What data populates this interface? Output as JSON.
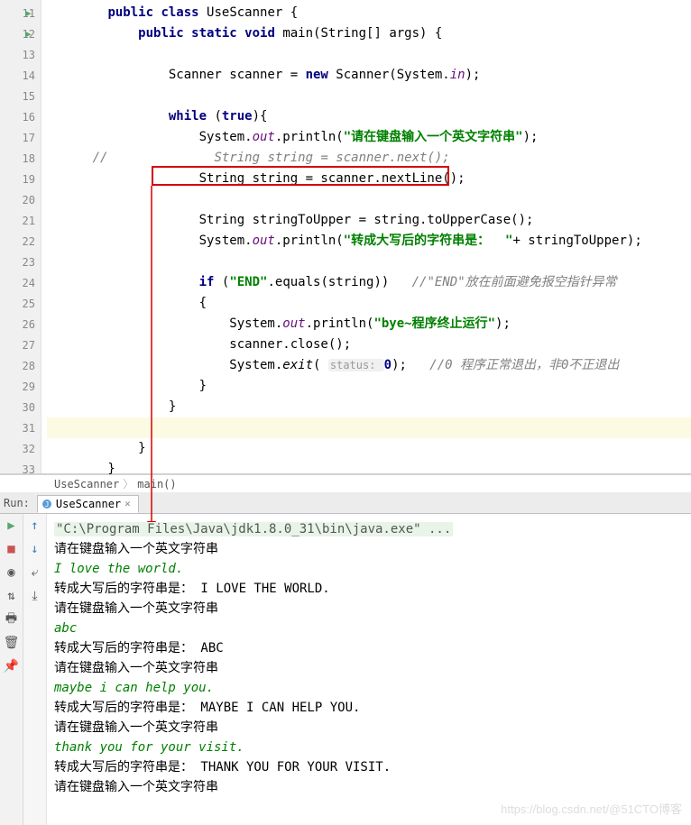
{
  "gutter": {
    "lines": [
      "11",
      "12",
      "13",
      "14",
      "15",
      "16",
      "17",
      "18",
      "19",
      "20",
      "21",
      "22",
      "23",
      "24",
      "25",
      "26",
      "27",
      "28",
      "29",
      "30",
      "31",
      "32",
      "33"
    ],
    "runMarkers": [
      11,
      12
    ]
  },
  "code": {
    "l11": {
      "indent": "        ",
      "tokens": [
        {
          "t": "public ",
          "c": "kw"
        },
        {
          "t": "class ",
          "c": "kw"
        },
        {
          "t": "UseScanner {",
          "c": ""
        }
      ]
    },
    "l12": {
      "indent": "            ",
      "tokens": [
        {
          "t": "public static void ",
          "c": "kw"
        },
        {
          "t": "main(String[] args) {",
          "c": ""
        }
      ]
    },
    "l14": {
      "indent": "                ",
      "tokens": [
        {
          "t": "Scanner scanner = ",
          "c": ""
        },
        {
          "t": "new ",
          "c": "kw"
        },
        {
          "t": "Scanner(System.",
          "c": ""
        },
        {
          "t": "in",
          "c": "static-field"
        },
        {
          "t": ");",
          "c": ""
        }
      ]
    },
    "l16": {
      "indent": "                ",
      "tokens": [
        {
          "t": "while ",
          "c": "kw"
        },
        {
          "t": "(",
          "c": ""
        },
        {
          "t": "true",
          "c": "kw"
        },
        {
          "t": "){",
          "c": ""
        }
      ]
    },
    "l17": {
      "indent": "                    ",
      "tokens": [
        {
          "t": "System.",
          "c": ""
        },
        {
          "t": "out",
          "c": "static-field"
        },
        {
          "t": ".println(",
          "c": ""
        },
        {
          "t": "\"请在键盘输入一个英文字符串\"",
          "c": "str"
        },
        {
          "t": ");",
          "c": ""
        }
      ]
    },
    "l18": {
      "indent": "      ",
      "tokens": [
        {
          "t": "//              String string = scanner.next();",
          "c": "comment"
        }
      ]
    },
    "l19": {
      "indent": "                    ",
      "tokens": [
        {
          "t": "String string = scanner.nextLine();",
          "c": ""
        }
      ]
    },
    "l21": {
      "indent": "                    ",
      "tokens": [
        {
          "t": "String stringToUpper = string.toUpperCase();",
          "c": ""
        }
      ]
    },
    "l22": {
      "indent": "                    ",
      "tokens": [
        {
          "t": "System.",
          "c": ""
        },
        {
          "t": "out",
          "c": "static-field"
        },
        {
          "t": ".println(",
          "c": ""
        },
        {
          "t": "\"转成大写后的字符串是：  \"",
          "c": "str"
        },
        {
          "t": "+ stringToUpper);",
          "c": ""
        }
      ]
    },
    "l24": {
      "indent": "                    ",
      "tokens": [
        {
          "t": "if ",
          "c": "kw"
        },
        {
          "t": "(",
          "c": ""
        },
        {
          "t": "\"END\"",
          "c": "str"
        },
        {
          "t": ".equals(string))   ",
          "c": ""
        },
        {
          "t": "//\"END\"放在前面避免报空指针异常",
          "c": "comment"
        }
      ]
    },
    "l25": {
      "indent": "                    ",
      "tokens": [
        {
          "t": "{",
          "c": ""
        }
      ]
    },
    "l26": {
      "indent": "                        ",
      "tokens": [
        {
          "t": "System.",
          "c": ""
        },
        {
          "t": "out",
          "c": "static-field"
        },
        {
          "t": ".println(",
          "c": ""
        },
        {
          "t": "\"bye~程序终止运行\"",
          "c": "str"
        },
        {
          "t": ");",
          "c": ""
        }
      ]
    },
    "l27": {
      "indent": "                        ",
      "tokens": [
        {
          "t": "scanner.close();",
          "c": ""
        }
      ]
    },
    "l28": {
      "indent": "                        ",
      "tokens": [
        {
          "t": "System.",
          "c": ""
        },
        {
          "t": "exit",
          "c": "static-method"
        },
        {
          "t": "( ",
          "c": ""
        },
        {
          "t": "status: ",
          "c": "hint"
        },
        {
          "t": "0",
          "c": "kw"
        },
        {
          "t": ");   ",
          "c": ""
        },
        {
          "t": "//0 程序正常退出，非0不正退出",
          "c": "comment"
        }
      ]
    },
    "l29": {
      "indent": "                    ",
      "tokens": [
        {
          "t": "}",
          "c": ""
        }
      ]
    },
    "l30": {
      "indent": "                ",
      "tokens": [
        {
          "t": "}",
          "c": ""
        }
      ]
    },
    "l32": {
      "indent": "            ",
      "tokens": [
        {
          "t": "}",
          "c": ""
        }
      ]
    },
    "l33": {
      "indent": "        ",
      "tokens": [
        {
          "t": "}",
          "c": ""
        }
      ]
    }
  },
  "breadcrumb": {
    "class": "UseScanner",
    "method": "main()"
  },
  "runBar": {
    "label": "Run:",
    "tab": "UseScanner"
  },
  "console": {
    "cmd": "\"C:\\Program Files\\Java\\jdk1.8.0_31\\bin\\java.exe\" ...",
    "lines": [
      {
        "t": "请在键盘输入一个英文字符串",
        "c": ""
      },
      {
        "t": "I love the world.",
        "c": "user-input"
      },
      {
        "t": "转成大写后的字符串是：  I LOVE THE WORLD.",
        "c": ""
      },
      {
        "t": "请在键盘输入一个英文字符串",
        "c": ""
      },
      {
        "t": "abc",
        "c": "user-input"
      },
      {
        "t": "转成大写后的字符串是：  ABC",
        "c": ""
      },
      {
        "t": "请在键盘输入一个英文字符串",
        "c": ""
      },
      {
        "t": "maybe i can help you.",
        "c": "user-input"
      },
      {
        "t": "转成大写后的字符串是：  MAYBE I CAN HELP YOU.",
        "c": ""
      },
      {
        "t": "请在键盘输入一个英文字符串",
        "c": ""
      },
      {
        "t": "thank you for your visit.",
        "c": "user-input"
      },
      {
        "t": "转成大写后的字符串是：  THANK YOU FOR YOUR VISIT.",
        "c": ""
      },
      {
        "t": "请在键盘输入一个英文字符串",
        "c": ""
      }
    ]
  },
  "watermark": "https://blog.csdn.net/@51CTO博客"
}
